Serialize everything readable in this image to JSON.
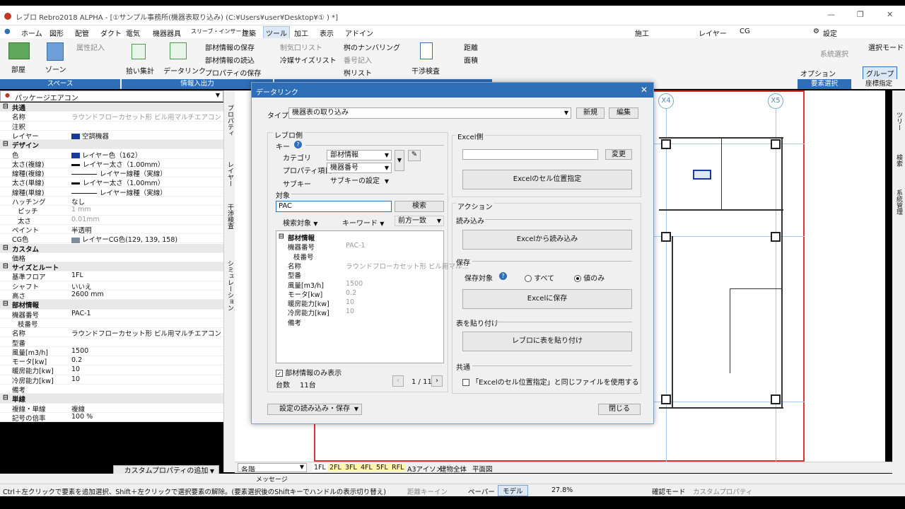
{
  "app": {
    "title": "レブロ Rebro2018 ALPHA - [①サンプル事務所(機器表取り込み) (C:¥Users¥user¥Desktop¥① ) *]"
  },
  "menu": {
    "items": [
      "ホーム",
      "図形",
      "配管",
      "ダクト",
      "電気",
      "機器器具",
      "スリーブ・インサート",
      "建築",
      "ツール",
      "加工",
      "表示",
      "アドイン"
    ],
    "active": "ツール",
    "right": [
      "施工",
      "レイヤー",
      "CG",
      "設定"
    ]
  },
  "ribbon": {
    "space": {
      "room": "部屋",
      "zone": "ゾーン",
      "attr_write": "属性記入",
      "group": "スペース"
    },
    "io": {
      "pickup": "拾い集計",
      "datalink": "データリンク",
      "save_member": "部材情報の保存",
      "load_member": "部材情報の読込",
      "save_prop": "プロパティの保存",
      "group": "情報入出力"
    },
    "misc": {
      "airflow_list": "制気口リスト",
      "cold_size": "冷媒サイズリスト",
      "box_numbering": "桝のナンバリング",
      "num_write": "番号記入",
      "box_list": "桝リスト",
      "interference": "干渉検査",
      "distance": "距離",
      "area": "面積"
    },
    "right": {
      "system_select": "系統選択",
      "select_mode": "選択モード",
      "option": "オプション",
      "group_btn": "グループ",
      "elem_select": "要素選択",
      "coord": "座標指定"
    }
  },
  "props": {
    "selected": "パッケージエアコン",
    "rows": [
      {
        "cat": true,
        "k": "共通"
      },
      {
        "k": "名称",
        "v": "ラウンドフローカセット形 ビル用マルチエアコン",
        "dim": true
      },
      {
        "k": "注釈",
        "v": ""
      },
      {
        "k": "レイヤー",
        "v": "空調機器",
        "swatch": "#1a3a9a"
      },
      {
        "cat": true,
        "k": "デザイン"
      },
      {
        "k": "色",
        "v": "レイヤー色（162）",
        "swatch": "#1a3a9a"
      },
      {
        "k": "太さ(複線)",
        "v": "レイヤー太さ（1.00mm）",
        "line": true
      },
      {
        "k": "線種(複線)",
        "v": "レイヤー線種（実線）",
        "thin": true
      },
      {
        "k": "太さ(単線)",
        "v": "レイヤー太さ（1.00mm）",
        "line": true
      },
      {
        "k": "線種(単線)",
        "v": "レイヤー線種（実線）",
        "thin": true
      },
      {
        "k": "ハッチング",
        "v": "なし"
      },
      {
        "k": "ピッチ",
        "v": "1 mm",
        "dim": true,
        "indent": true
      },
      {
        "k": "太さ",
        "v": "0.01mm",
        "dim": true,
        "indent": true
      },
      {
        "k": "ペイント",
        "v": "半透明"
      },
      {
        "k": "CG色",
        "v": "レイヤーCG色(129, 139, 158)",
        "swatch": "#818b9e"
      },
      {
        "cat": true,
        "k": "カスタム"
      },
      {
        "k": "価格",
        "v": ""
      },
      {
        "cat": true,
        "k": "サイズとルート"
      },
      {
        "k": "基準フロア",
        "v": "1FL"
      },
      {
        "k": "シャフト",
        "v": "いいえ"
      },
      {
        "k": "高さ",
        "v": "2600 mm"
      },
      {
        "cat": true,
        "k": "部材情報"
      },
      {
        "k": "機器番号",
        "v": "PAC-1"
      },
      {
        "k": "枝番号",
        "v": "",
        "indent": true
      },
      {
        "k": "名称",
        "v": "ラウンドフローカセット形 ビル用マルチエアコン"
      },
      {
        "k": "型番",
        "v": ""
      },
      {
        "k": "風量[m3/h]",
        "v": "1500"
      },
      {
        "k": "モータ[kw]",
        "v": "0.2"
      },
      {
        "k": "暖房能力[kw]",
        "v": "10"
      },
      {
        "k": "冷房能力[kw]",
        "v": "10"
      },
      {
        "k": "備考",
        "v": ""
      },
      {
        "cat": true,
        "k": "単線"
      },
      {
        "k": "複線・単線",
        "v": "複線"
      },
      {
        "k": "記号の倍率",
        "v": "100 %"
      }
    ],
    "custom_btn": "カスタムプロパティの追加"
  },
  "sidetabs": [
    "プロパティ",
    "レイヤー",
    "干渉検査",
    "シミュレーション"
  ],
  "righttabs": [
    "ツリー",
    "検索",
    "系統管理"
  ],
  "canvas": {
    "axes": [
      "X4",
      "X5"
    ]
  },
  "floors": {
    "select": "各階",
    "tabs": [
      "1FL",
      "2FL",
      "3FL",
      "4FL",
      "5FL",
      "RFL",
      "A3アイソメ",
      "建物全体",
      "平面図"
    ]
  },
  "message": "メッセージ",
  "status": {
    "hint": "Ctrl＋左クリックで要素を追加選択、Shift＋左クリックで選択要素の解除。(要素選択後のShiftキーでハンドルの表示切り替え)",
    "distance_key": "距離キーイン",
    "paper": "ペーパー",
    "model": "モデル",
    "zoom": "27.8%",
    "confirm": "確認モード",
    "custom_prop": "カスタムプロパティ"
  },
  "dialog": {
    "title": "データリンク",
    "type_label": "タイプ",
    "type_value": "機器表の取り込み",
    "new_btn": "新規",
    "edit_btn": "編集",
    "rebro_side": "レブロ側",
    "key_label": "キー",
    "category_label": "カテゴリ",
    "category_value": "部材情報",
    "prop_label": "プロパティ項目",
    "prop_value": "機器番号",
    "subkey_label": "サブキー",
    "subkey_value": "サブキーの設定",
    "target_label": "対象",
    "search_value": "PAC",
    "search_btn": "検索",
    "search_target": "検索対象",
    "keyword": "キーワード",
    "prefix_match": "前方一致",
    "tree": {
      "header": "部材情報",
      "rows": [
        {
          "k": "機器番号",
          "v": "PAC-1"
        },
        {
          "k": "枝番号",
          "v": "",
          "indent": true
        },
        {
          "k": "名称",
          "v": "ラウンドフローカセット形 ビル用マル..."
        },
        {
          "k": "型番",
          "v": ""
        },
        {
          "k": "風量[m3/h]",
          "v": "1500"
        },
        {
          "k": "モータ[kw]",
          "v": "0.2"
        },
        {
          "k": "暖房能力[kw]",
          "v": "10"
        },
        {
          "k": "冷房能力[kw]",
          "v": "10"
        },
        {
          "k": "備考",
          "v": ""
        }
      ]
    },
    "only_member": "部材情報のみ表示",
    "count_label": "台数",
    "count_value": "11台",
    "page": "1 / 11",
    "excel_side": "Excel側",
    "change_btn": "変更",
    "cell_pos_btn": "Excelのセル位置指定",
    "action": "アクション",
    "read_label": "読み込み",
    "read_btn": "Excelから読み込み",
    "save_label": "保存",
    "save_target": "保存対象",
    "opt_all": "すべて",
    "opt_value": "値のみ",
    "save_btn": "Excelに保存",
    "paste_label": "表を貼り付け",
    "paste_btn": "レブロに表を貼り付け",
    "common_label": "共通",
    "same_file": "「Excelのセル位置指定」と同じファイルを使用する",
    "settings_btn": "設定の読み込み・保存",
    "close_btn": "閉じる"
  }
}
